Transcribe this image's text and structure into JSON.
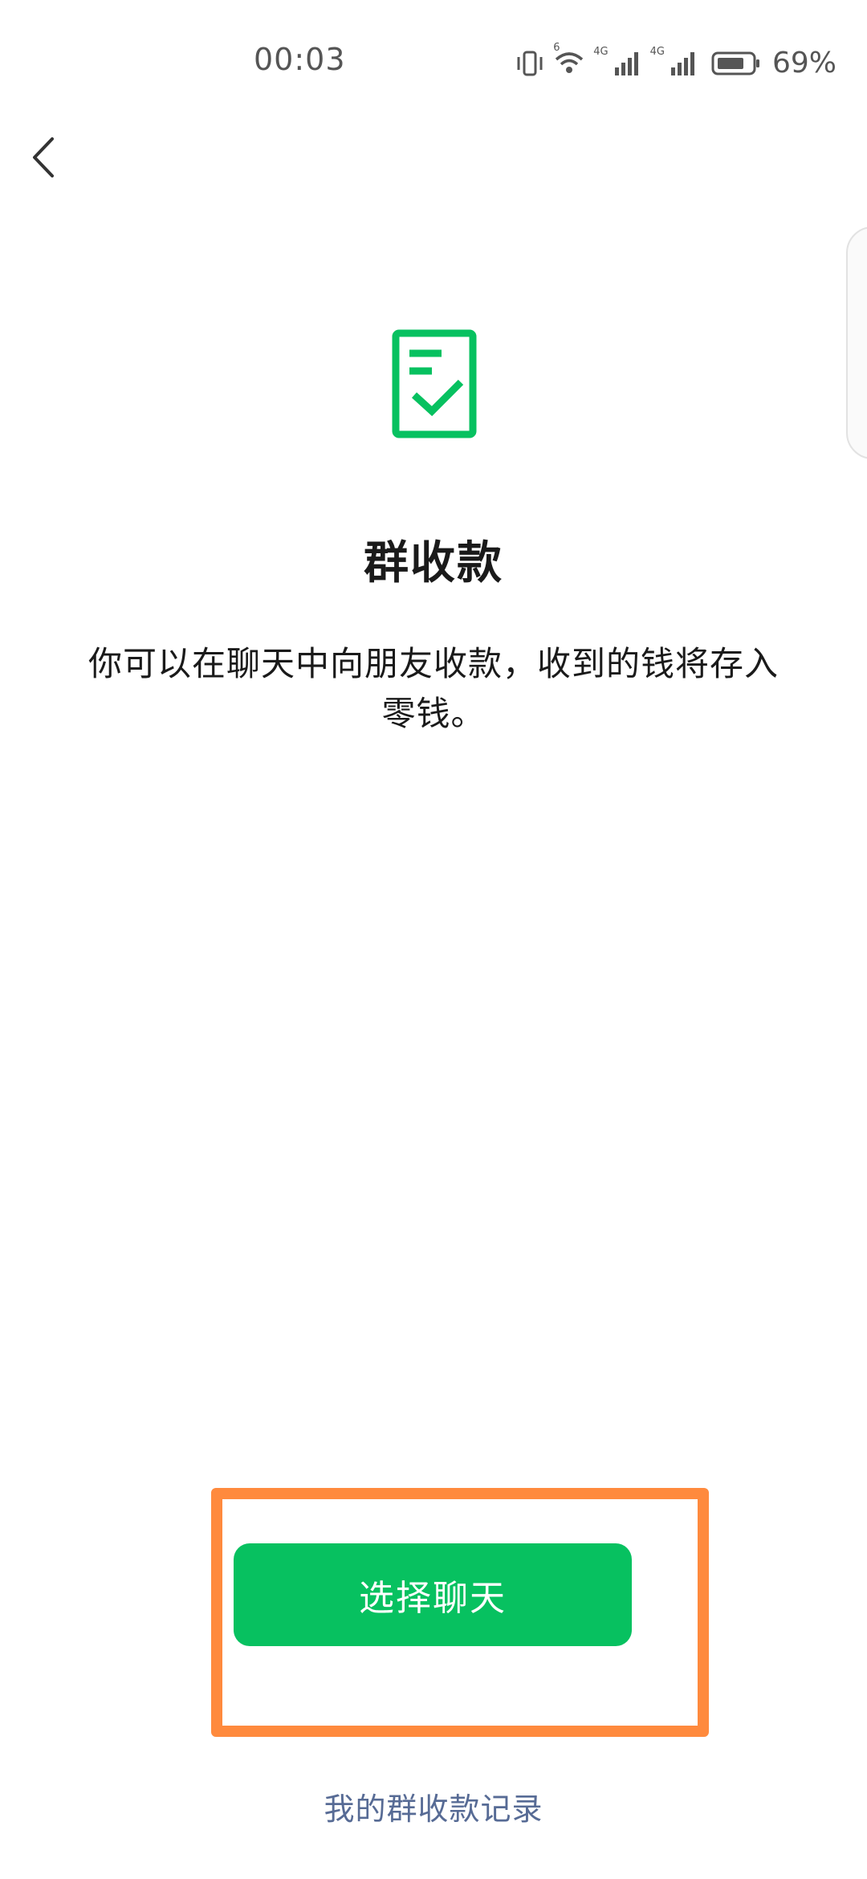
{
  "status_bar": {
    "time": "00:03",
    "battery_percent": "69%",
    "icons": [
      "vibrate-icon",
      "wifi-icon",
      "signal-4g-icon",
      "signal-4g-icon",
      "battery-icon"
    ],
    "signal_labels": [
      "4G",
      "4G"
    ],
    "wifi_label": "6"
  },
  "nav": {
    "back_icon": "chevron-left-icon"
  },
  "main": {
    "icon": "document-check-icon",
    "title": "群收款",
    "description": "你可以在聊天中向朋友收款，收到的钱将存入零钱。"
  },
  "actions": {
    "primary_label": "选择聊天",
    "secondary_link": "我的群收款记录"
  },
  "colors": {
    "brand_green": "#07C160",
    "link_blue": "#576B95",
    "highlight_orange": "#FF8A3D"
  }
}
